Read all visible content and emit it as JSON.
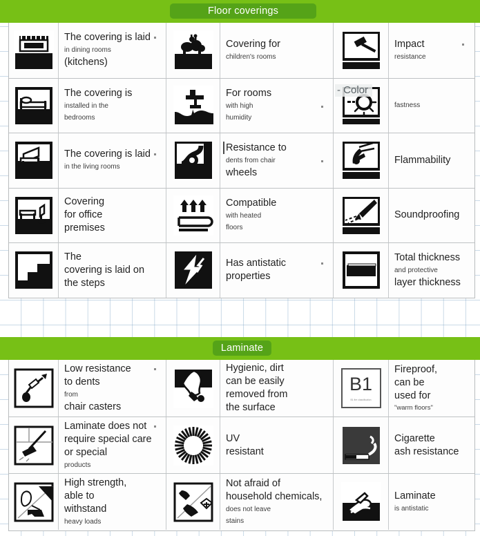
{
  "sections": [
    {
      "id": "floor-coverings",
      "banner_label": "Floor coverings",
      "rows": [
        {
          "left": {
            "icon": "stove-kitchen-icon",
            "lines": [
              {
                "t": "The covering is laid",
                "s": "big",
                "dot": true
              },
              {
                "t": "in dining rooms",
                "s": "small"
              },
              {
                "t": "(kitchens)",
                "s": "big"
              }
            ]
          },
          "mid": {
            "icon": "toys-children-icon",
            "lines": [
              {
                "t": "Covering for",
                "s": "big"
              },
              {
                "t": "children's rooms",
                "s": "small"
              }
            ]
          },
          "right": {
            "icon": "hammer-impact-icon",
            "lines": [
              {
                "t": "Impact",
                "s": "big",
                "dot": true
              },
              {
                "t": "resistance",
                "s": "small"
              }
            ]
          }
        },
        {
          "left": {
            "icon": "bed-bedroom-icon",
            "lines": [
              {
                "t": "The covering is",
                "s": "big"
              },
              {
                "t": "installed in the",
                "s": "small"
              },
              {
                "t": "bedrooms",
                "s": "small"
              }
            ]
          },
          "mid": {
            "icon": "faucet-humidity-icon",
            "lines": [
              {
                "t": "For rooms",
                "s": "big"
              },
              {
                "t": "with high",
                "s": "small",
                "dot": true
              },
              {
                "t": "humidity",
                "s": "small"
              }
            ]
          },
          "right": {
            "icon": "sun-colorfastness-icon",
            "overlay": "- Color",
            "lines": [
              {
                "t": "fastness",
                "s": "small"
              }
            ]
          }
        },
        {
          "left": {
            "icon": "armchair-livingroom-icon",
            "lines": [
              {
                "t": "The covering is laid",
                "s": "big",
                "dot": true
              },
              {
                "t": "in the living rooms",
                "s": "small"
              }
            ]
          },
          "mid": {
            "icon": "chair-caster-wheel-icon",
            "vbar": true,
            "lines": [
              {
                "t": "Resistance to",
                "s": "big"
              },
              {
                "t": "dents from chair",
                "s": "small",
                "dot": true
              },
              {
                "t": "wheels",
                "s": "big"
              }
            ]
          },
          "right": {
            "icon": "match-flame-icon",
            "lines": [
              {
                "t": "Flammability",
                "s": "big"
              }
            ]
          }
        },
        {
          "left": {
            "icon": "desk-office-icon",
            "lines": [
              {
                "t": "Covering",
                "s": "big"
              },
              {
                "t": "for office",
                "s": "big"
              },
              {
                "t": "premises",
                "s": "big"
              }
            ]
          },
          "mid": {
            "icon": "heated-floor-arrows-icon",
            "lines": [
              {
                "t": "Compatible",
                "s": "big"
              },
              {
                "t": "with heated",
                "s": "small"
              },
              {
                "t": "floors",
                "s": "small"
              }
            ]
          },
          "right": {
            "icon": "sound-dampening-icon",
            "lines": [
              {
                "t": "Soundproofing",
                "s": "big"
              }
            ]
          }
        },
        {
          "left": {
            "icon": "stairs-steps-icon",
            "lines": [
              {
                "t": "The",
                "s": "big"
              },
              {
                "t": "covering is laid on",
                "s": "big"
              },
              {
                "t": "the steps",
                "s": "big"
              }
            ]
          },
          "mid": {
            "icon": "antistatic-bolt-icon",
            "lines": [
              {
                "t": "Has antistatic",
                "s": "big",
                "dot": true
              },
              {
                "t": "properties",
                "s": "big"
              }
            ]
          },
          "right": {
            "icon": "total-thickness-icon",
            "lines": [
              {
                "t": "Total thickness",
                "s": "big"
              },
              {
                "t": "and protective",
                "s": "small"
              },
              {
                "t": "layer thickness",
                "s": "big"
              }
            ]
          }
        }
      ]
    },
    {
      "id": "laminate",
      "banner_label": "Laminate",
      "rows": [
        {
          "left": {
            "icon": "caster-dent-icon",
            "lines": [
              {
                "t": "Low resistance",
                "s": "big",
                "dot": true
              },
              {
                "t": "to dents",
                "s": "big"
              },
              {
                "t": "from",
                "s": "small"
              },
              {
                "t": "chair casters",
                "s": "big"
              }
            ]
          },
          "mid": {
            "icon": "hand-wiping-dirt-icon",
            "lines": [
              {
                "t": "Hygienic, dirt",
                "s": "big"
              },
              {
                "t": "can be easily",
                "s": "big"
              },
              {
                "t": "removed from",
                "s": "big"
              },
              {
                "t": "the surface",
                "s": "big"
              }
            ]
          },
          "right": {
            "icon": "b1-fireproof-icon",
            "icon_text": "B1",
            "icon_subtext": "B1 fire classification",
            "lines": [
              {
                "t": "Fireproof,",
                "s": "big"
              },
              {
                "t": "can be",
                "s": "big"
              },
              {
                "t": "used for",
                "s": "big"
              },
              {
                "t": "\"warm floors\"",
                "s": "quote"
              }
            ]
          }
        },
        {
          "left": {
            "icon": "mop-cleaning-icon",
            "lines": [
              {
                "t": "Laminate does not",
                "s": "big",
                "dot": true
              },
              {
                "t": "require special care",
                "s": "big"
              },
              {
                "t": "or special",
                "s": "big"
              },
              {
                "t": "products",
                "s": "small"
              }
            ]
          },
          "mid": {
            "icon": "sun-uv-rays-icon",
            "lines": [
              {
                "t": "UV",
                "s": "big"
              },
              {
                "t": "resistant",
                "s": "big"
              }
            ]
          },
          "right": {
            "icon": "cigarette-ash-icon",
            "lines": [
              {
                "t": "Cigarette",
                "s": "big"
              },
              {
                "t": "ash resistance",
                "s": "big"
              }
            ]
          }
        },
        {
          "left": {
            "icon": "high-heel-strength-icon",
            "lines": [
              {
                "t": "High strength,",
                "s": "big"
              },
              {
                "t": "able to",
                "s": "big"
              },
              {
                "t": "withstand",
                "s": "big"
              },
              {
                "t": "heavy loads",
                "s": "small"
              }
            ]
          },
          "mid": {
            "icon": "chemical-spill-icon",
            "lines": [
              {
                "t": "Not afraid of",
                "s": "big"
              },
              {
                "t": "household chemicals,",
                "s": "big"
              },
              {
                "t": "does not leave",
                "s": "small"
              },
              {
                "t": "stains",
                "s": "small"
              }
            ]
          },
          "right": {
            "icon": "antistatic-hand-icon",
            "lines": [
              {
                "t": "Laminate",
                "s": "big"
              },
              {
                "t": "is antistatic",
                "s": "small"
              }
            ]
          }
        }
      ]
    }
  ],
  "colors": {
    "banner_green": "#77c016",
    "pill_green": "#55a318",
    "grid_blue": "#7ba0c3",
    "border_grey": "#bfc2c4"
  }
}
